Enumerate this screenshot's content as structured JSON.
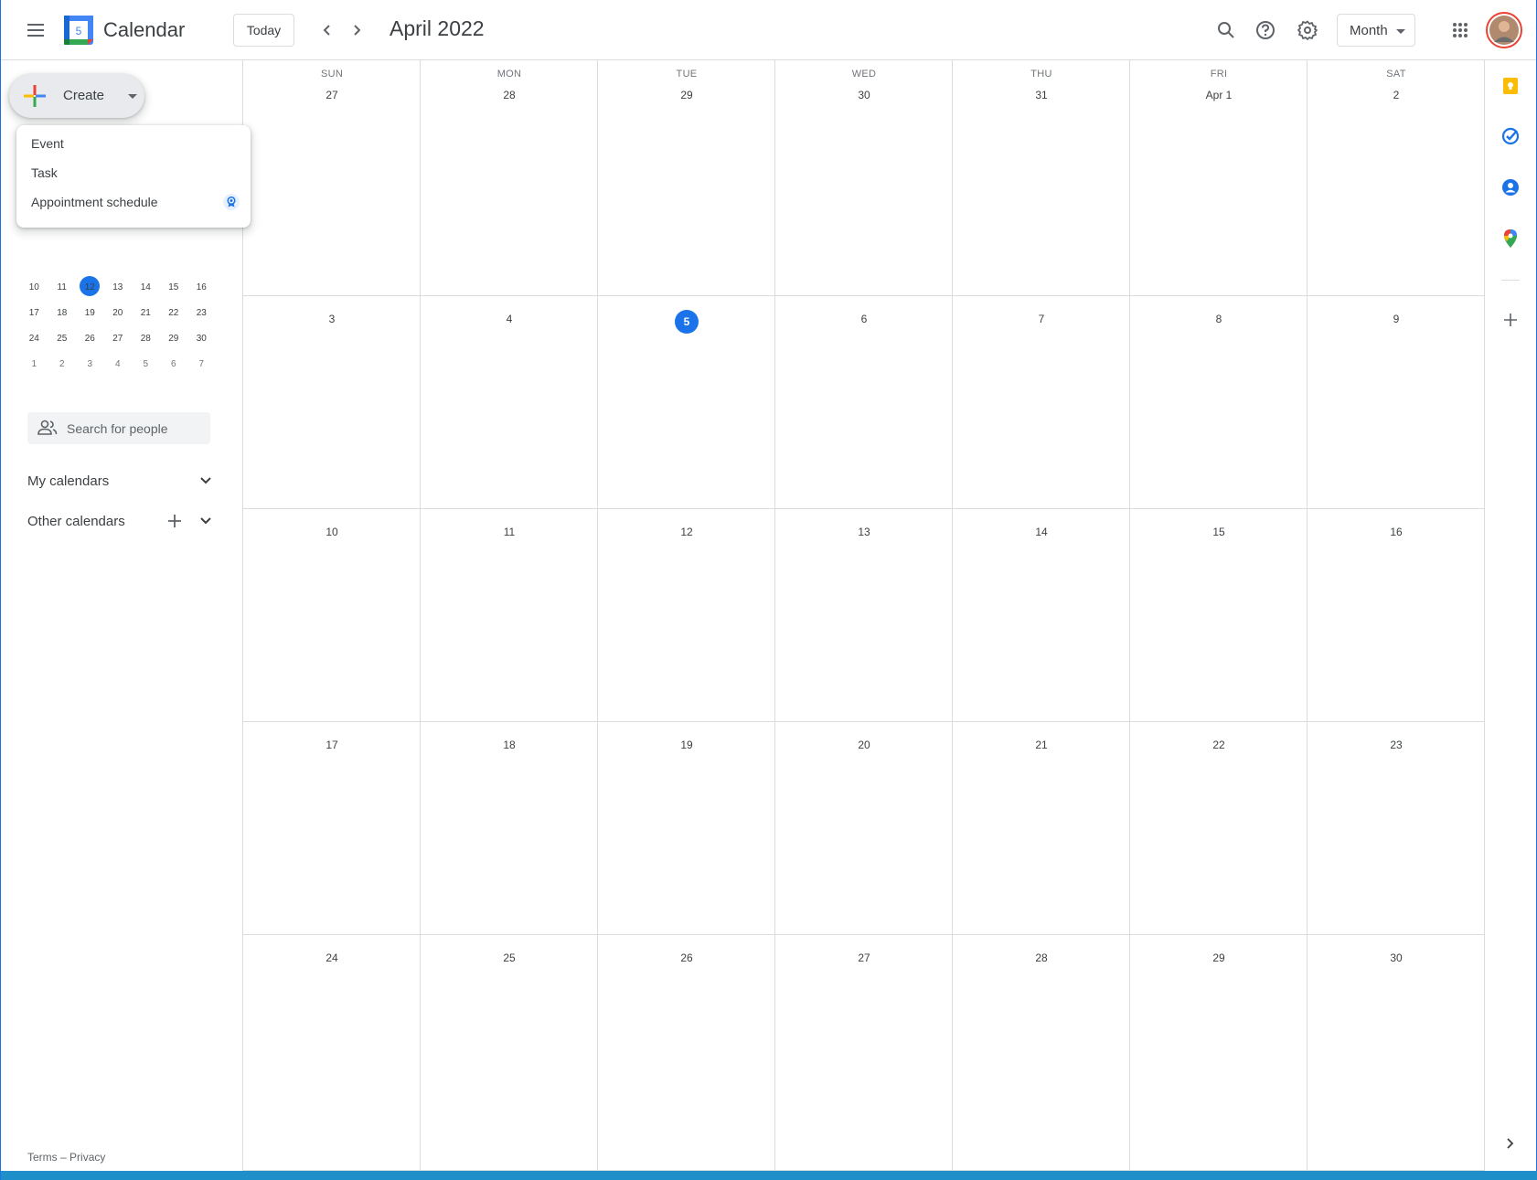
{
  "header": {
    "app_title": "Calendar",
    "logo_day": "5",
    "today_label": "Today",
    "month_title": "April 2022",
    "view_label": "Month"
  },
  "create": {
    "label": "Create",
    "menu": [
      "Event",
      "Task",
      "Appointment schedule"
    ]
  },
  "mini_calendar": {
    "rows": [
      [
        "10",
        "11",
        "12",
        "13",
        "14",
        "15",
        "16"
      ],
      [
        "17",
        "18",
        "19",
        "20",
        "21",
        "22",
        "23"
      ],
      [
        "24",
        "25",
        "26",
        "27",
        "28",
        "29",
        "30"
      ],
      [
        "1",
        "2",
        "3",
        "4",
        "5",
        "6",
        "7"
      ]
    ],
    "selected_day": "5"
  },
  "people_search": {
    "placeholder": "Search for people"
  },
  "sections": {
    "my_calendars": "My calendars",
    "other_calendars": "Other calendars"
  },
  "footer": {
    "terms": "Terms",
    "separator": "–",
    "privacy": "Privacy"
  },
  "month_grid": {
    "weekdays": [
      "SUN",
      "MON",
      "TUE",
      "WED",
      "THU",
      "FRI",
      "SAT"
    ],
    "weeks": [
      [
        "27",
        "28",
        "29",
        "30",
        "31",
        "Apr 1",
        "2"
      ],
      [
        "3",
        "4",
        "5",
        "6",
        "7",
        "8",
        "9"
      ],
      [
        "10",
        "11",
        "12",
        "13",
        "14",
        "15",
        "16"
      ],
      [
        "17",
        "18",
        "19",
        "20",
        "21",
        "22",
        "23"
      ],
      [
        "24",
        "25",
        "26",
        "27",
        "28",
        "29",
        "30"
      ]
    ],
    "today": "5"
  },
  "colors": {
    "accent": "#1a73e8",
    "keep": "#fbbc04",
    "tasks": "#1a73e8",
    "contacts": "#1a73e8",
    "maps": "#34a853"
  },
  "icons": {
    "menu": "hamburger-icon",
    "search": "search-icon",
    "help": "help-icon",
    "settings": "gear-icon",
    "apps": "apps-grid-icon",
    "keep": "keep-icon",
    "tasks": "tasks-icon",
    "contacts": "contacts-icon",
    "maps": "maps-icon",
    "add": "plus-icon",
    "expand": "chevron-right-icon"
  }
}
